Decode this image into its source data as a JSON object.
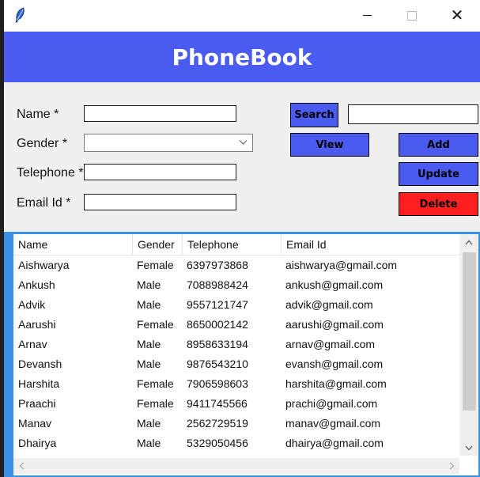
{
  "window": {
    "minimize_glyph": "",
    "close_glyph": "✕"
  },
  "header": {
    "title": "PhoneBook"
  },
  "form": {
    "name_label": "Name *",
    "gender_label": "Gender *",
    "telephone_label": "Telephone *",
    "email_label": "Email Id *",
    "name_value": "",
    "gender_value": "",
    "telephone_value": "",
    "email_value": "",
    "search_value": ""
  },
  "buttons": {
    "search": "Search",
    "view": "View",
    "add": "Add",
    "update": "Update",
    "delete": "Delete"
  },
  "colors": {
    "header_bg": "#4a5cf0",
    "button_blue": "#4a5cf0",
    "delete_red": "#ff1f1f",
    "table_border": "#3c91e6"
  },
  "table": {
    "columns": [
      "Name",
      "Gender",
      "Telephone",
      "Email Id"
    ],
    "rows": [
      [
        "Aishwarya",
        "Female",
        "6397973868",
        "aishwarya@gmail.com"
      ],
      [
        "Ankush",
        "Male",
        "7088988424",
        "ankush@gmail.com"
      ],
      [
        "Advik",
        "Male",
        "9557121747",
        "advik@gmail.com"
      ],
      [
        "Aarushi",
        "Female",
        "8650002142",
        "aarushi@gmail.com"
      ],
      [
        "Arnav",
        "Male",
        "8958633194",
        "arnav@gmail.com"
      ],
      [
        "Devansh",
        "Male",
        "9876543210",
        "evansh@gmail.com"
      ],
      [
        "Harshita",
        "Female",
        "7906598603",
        "harshita@gmail.com"
      ],
      [
        "Praachi",
        "Female",
        "9411745566",
        "prachi@gmail.com"
      ],
      [
        "Manav",
        "Male",
        "2562729519",
        "manav@gmail.com"
      ],
      [
        "Dhairya",
        "Male",
        "5329050456",
        "dhairya@gmail.com"
      ]
    ]
  },
  "icons": {
    "app": "feather-icon",
    "combo": "chevron-down-icon",
    "scroll_up": "chevron-up-icon",
    "scroll_down": "chevron-down-icon",
    "scroll_left": "chevron-left-icon",
    "scroll_right": "chevron-right-icon"
  }
}
